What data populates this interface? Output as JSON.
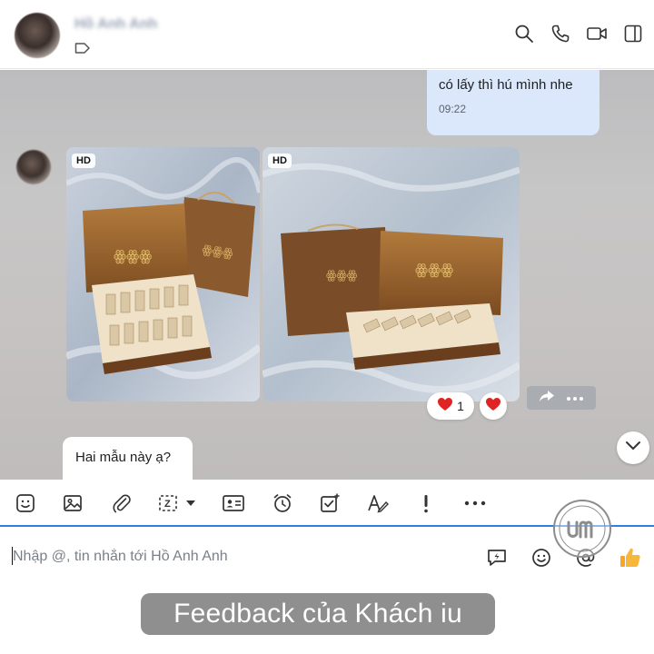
{
  "header": {
    "contact_name": "Hồ Anh Anh",
    "icons": [
      "search-icon",
      "phone-icon",
      "video-icon",
      "sidebar-toggle-icon"
    ]
  },
  "messages": {
    "outgoing": {
      "text": "có lấy thì hú mình nhe",
      "time": "09:22"
    },
    "photos": [
      {
        "badge": "HD"
      },
      {
        "badge": "HD"
      }
    ],
    "reactions": {
      "heart_count": "1"
    },
    "incoming": {
      "text": "Hai mẫu này ạ?"
    }
  },
  "toolbar": {
    "items": [
      "sticker-icon",
      "image-icon",
      "attachment-icon",
      "screenshot-icon",
      "contact-card-icon",
      "reminder-icon",
      "task-icon",
      "formatting-icon",
      "urgent-icon",
      "more-icon"
    ]
  },
  "composer": {
    "placeholder": "Nhập @, tin nhắn tới Hồ Anh Anh",
    "value": ""
  },
  "footer": {
    "caption": "Feedback của Khách iu"
  },
  "colors": {
    "accent": "#2f7fe8",
    "outgoing_bubble": "#dbe8fb",
    "heart": "#e02424",
    "like": "#f5a623"
  }
}
